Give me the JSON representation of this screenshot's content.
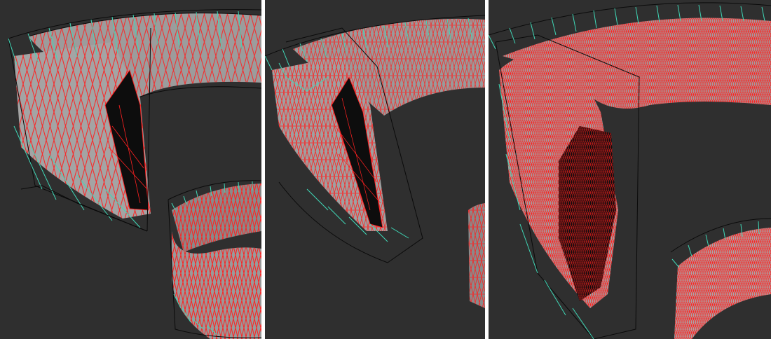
{
  "figure": {
    "panels": [
      {
        "id": "coarse-mesh-view",
        "mesh_density": "coarse"
      },
      {
        "id": "medium-mesh-view",
        "mesh_density": "medium"
      },
      {
        "id": "fine-mesh-view",
        "mesh_density": "fine"
      }
    ]
  },
  "colors": {
    "background": "#2f2f2f",
    "divider": "#ffffff",
    "surface": "#9a9a9a",
    "surface_shadow": "#0d0d0d",
    "wire_mesh": "#ff1a1a",
    "control_cage_teal": "#3fd9b8",
    "control_cage_black": "#0a0a0a"
  }
}
